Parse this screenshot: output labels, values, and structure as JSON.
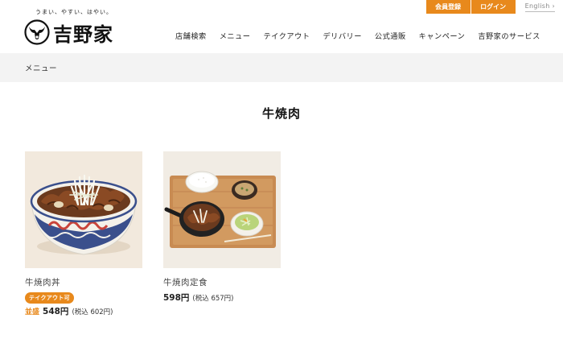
{
  "header": {
    "tagline": "うまい、やすい、はやい。",
    "brand_name": "吉野家",
    "register_label": "会員登録",
    "login_label": "ログイン",
    "language_link": "English",
    "nav": [
      {
        "label": "店舗検索"
      },
      {
        "label": "メニュー"
      },
      {
        "label": "テイクアウト"
      },
      {
        "label": "デリバリー"
      },
      {
        "label": "公式通販"
      },
      {
        "label": "キャンペーン"
      },
      {
        "label": "吉野家のサービス"
      }
    ]
  },
  "breadcrumb": {
    "current": "メニュー"
  },
  "page": {
    "title": "牛焼肉"
  },
  "menu_items": [
    {
      "name": "牛焼肉丼",
      "badge": "テイクアウト可",
      "size_label": "並盛",
      "price": "548円",
      "tax_note": "(税込 602円)"
    },
    {
      "name": "牛焼肉定食",
      "price": "598円",
      "tax_note": "(税込 657円)"
    }
  ],
  "colors": {
    "accent": "#e8891c",
    "breadcrumb_bg": "#f3f3f3",
    "text": "#222222"
  }
}
